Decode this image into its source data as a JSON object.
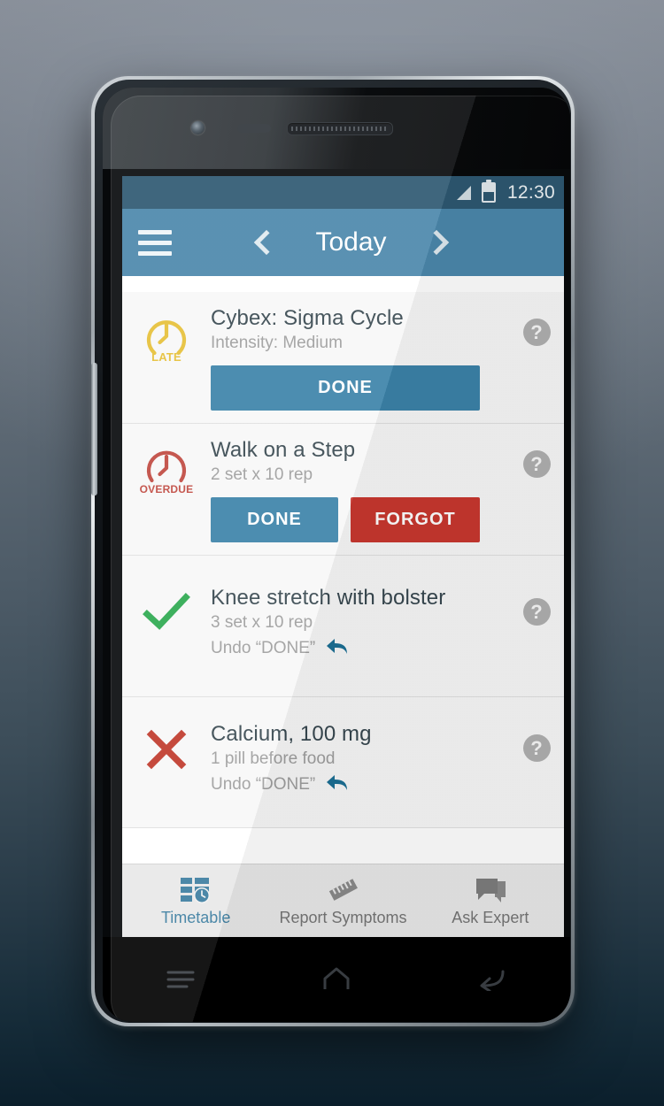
{
  "colors": {
    "accent": "#3b82a8",
    "appbar": "#4b87ab",
    "statusbar": "#2d5871",
    "danger": "#c8372f",
    "late": "#e6c038",
    "overdue": "#c0483f",
    "done_check": "#2ca84f",
    "missed_x": "#c0392b",
    "list_bg": "#f7f7f7",
    "tabbar_bg": "#e8e8e8"
  },
  "statusbar": {
    "time": "12:30",
    "signal_icon": "signal-bars-icon",
    "battery_icon": "battery-icon"
  },
  "appbar": {
    "menu_icon": "hamburger-menu-icon",
    "prev_icon": "chevron-left-icon",
    "title": "Today",
    "next_icon": "chevron-right-icon"
  },
  "list": {
    "items": [
      {
        "status": "late",
        "status_label": "LATE",
        "status_icon": "clock-late-icon",
        "title": "Cybex: Sigma Cycle",
        "subtitle": "Intensity: Medium",
        "help_icon": "help-question-icon",
        "buttons": [
          {
            "label": "DONE",
            "kind": "done-wide",
            "name": "done-button"
          }
        ]
      },
      {
        "status": "overdue",
        "status_label": "OVERDUE",
        "status_icon": "clock-overdue-icon",
        "title": "Walk on a Step",
        "subtitle": "2 set x 10 rep",
        "help_icon": "help-question-icon",
        "buttons": [
          {
            "label": "DONE",
            "kind": "done",
            "name": "done-button"
          },
          {
            "label": "FORGOT",
            "kind": "forgot",
            "name": "forgot-button"
          }
        ]
      },
      {
        "status": "completed",
        "status_icon": "green-check-icon",
        "title": "Knee stretch with bolster",
        "subtitle": "3 set x 10 rep",
        "undo_text": "Undo “DONE”",
        "undo_icon": "undo-arrow-icon",
        "help_icon": "help-question-icon",
        "buttons": []
      },
      {
        "status": "missed",
        "status_icon": "red-cross-icon",
        "title": "Calcium, 100 mg",
        "subtitle": "1 pill before food",
        "undo_text": "Undo “DONE”",
        "undo_icon": "undo-arrow-icon",
        "help_icon": "help-question-icon",
        "buttons": []
      }
    ]
  },
  "tabbar": {
    "tabs": [
      {
        "label": "Timetable",
        "icon": "timetable-clock-icon",
        "active": true
      },
      {
        "label": "Report Symptoms",
        "icon": "ruler-icon",
        "active": false
      },
      {
        "label": "Ask Expert",
        "icon": "chat-bubbles-icon",
        "active": false
      }
    ]
  },
  "navbar": {
    "recents_icon": "recent-apps-icon",
    "home_icon": "home-icon",
    "back_icon": "back-arrow-icon"
  },
  "hardware": {
    "front_camera": "front-camera",
    "proximity_sensor": "proximity-sensor",
    "earpiece": "earpiece-speaker",
    "volume_rocker": "volume-rocker-button"
  }
}
